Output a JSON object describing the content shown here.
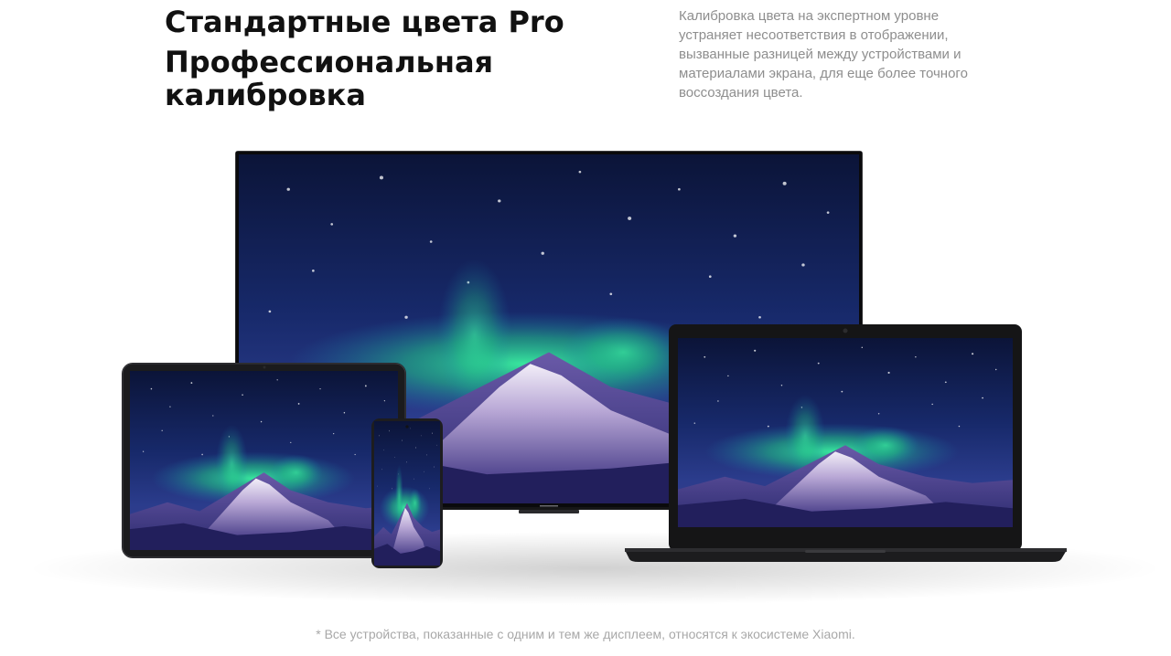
{
  "header": {
    "title_line_1": "Стандартные цвета Pro",
    "title_line_2": "Профессиональная\nкалибровка"
  },
  "description": "Калибровка цвета на экспертном уровне устраняет несоответствия в отображении, вызванные разницей между устройствами и материалами экрана, для еще более точного воссоздания цвета.",
  "footnote": "* Все устройства, показанные с одним и тем же дисплеем, относятся к экосистеме Xiaomi.",
  "colors": {
    "text_primary": "#111111",
    "text_secondary": "#8e8e8e",
    "night_sky": "#0f1b4a",
    "aurora": "#22e08a"
  },
  "devices": [
    "tv",
    "tablet",
    "smartphone",
    "laptop"
  ]
}
